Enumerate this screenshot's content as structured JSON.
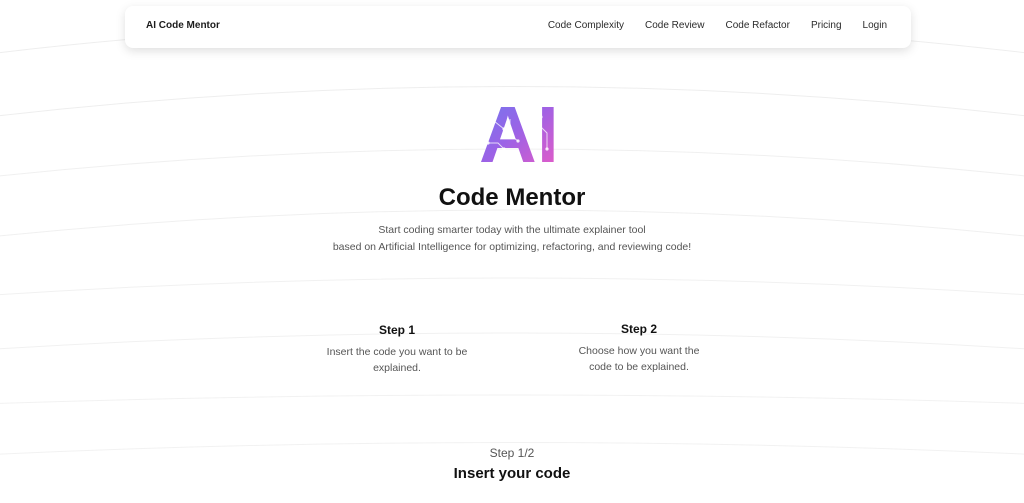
{
  "navbar": {
    "brand": "AI Code Mentor",
    "links": [
      "Code Complexity",
      "Code Review",
      "Code Refactor",
      "Pricing",
      "Login"
    ]
  },
  "hero": {
    "logo_text": "AI",
    "logo_gradient": [
      "#6a7df0",
      "#9b62e6",
      "#e65bc6"
    ],
    "title": "Code Mentor",
    "description_line1": "Start coding smarter today with the ultimate explainer tool",
    "description_line2": "based on Artificial Intelligence for optimizing, refactoring, and reviewing code!"
  },
  "steps": [
    {
      "title": "Step 1",
      "description_line1": "Insert the code you want to be",
      "description_line2": "explained."
    },
    {
      "title": "Step 2",
      "description_line1": "Choose how you want the",
      "description_line2": "code to be explained."
    }
  ],
  "wizard": {
    "progress": "Step 1/2",
    "title": "Insert your code"
  }
}
